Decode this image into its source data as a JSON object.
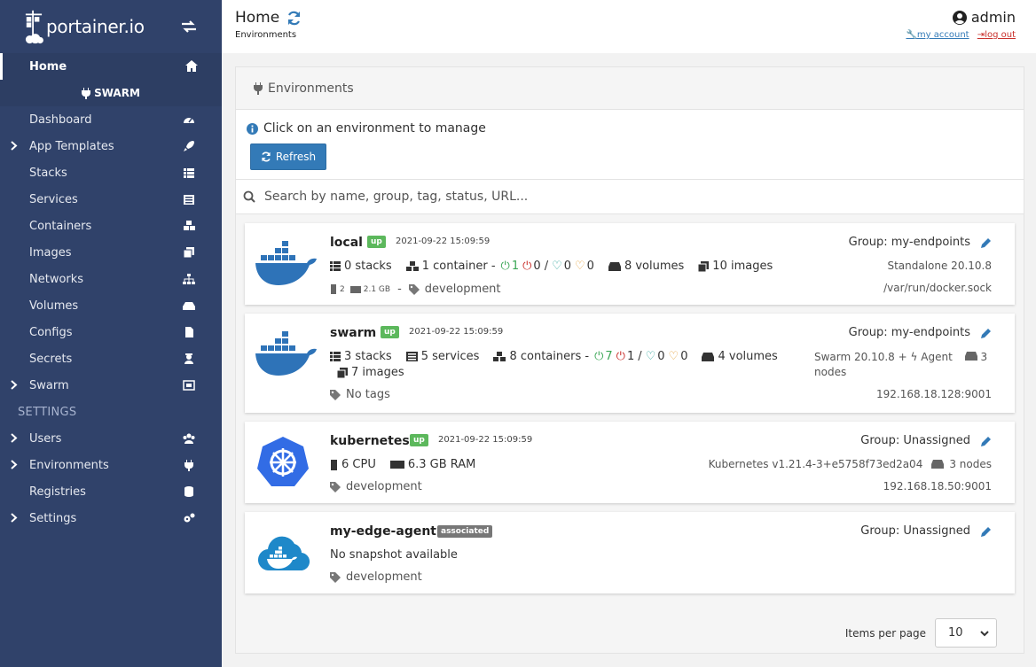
{
  "app": {
    "logo_text": "portainer.io"
  },
  "sidebar": {
    "home": "Home",
    "section": "SWARM",
    "items": [
      {
        "label": "Dashboard",
        "icon": "tachometer-icon",
        "chevron": false
      },
      {
        "label": "App Templates",
        "icon": "rocket-icon",
        "chevron": true
      },
      {
        "label": "Stacks",
        "icon": "th-list-icon",
        "chevron": false
      },
      {
        "label": "Services",
        "icon": "list-alt-icon",
        "chevron": false
      },
      {
        "label": "Containers",
        "icon": "cubes-icon",
        "chevron": false
      },
      {
        "label": "Images",
        "icon": "clone-icon",
        "chevron": false
      },
      {
        "label": "Networks",
        "icon": "sitemap-icon",
        "chevron": false
      },
      {
        "label": "Volumes",
        "icon": "hdd-icon",
        "chevron": false
      },
      {
        "label": "Configs",
        "icon": "file-code-icon",
        "chevron": false
      },
      {
        "label": "Secrets",
        "icon": "user-secret-icon",
        "chevron": false
      },
      {
        "label": "Swarm",
        "icon": "object-group-icon",
        "chevron": true
      }
    ],
    "settings_head": "SETTINGS",
    "settings_items": [
      {
        "label": "Users",
        "icon": "users-icon",
        "chevron": true
      },
      {
        "label": "Environments",
        "icon": "plug-icon",
        "chevron": true
      },
      {
        "label": "Registries",
        "icon": "database-icon",
        "chevron": false
      },
      {
        "label": "Settings",
        "icon": "cogs-icon",
        "chevron": true
      }
    ]
  },
  "header": {
    "title": "Home",
    "breadcrumb": "Environments",
    "user": "admin",
    "my_account": "my account",
    "log_out": "log out"
  },
  "widget": {
    "title": "Environments",
    "info": "Click on an environment to manage",
    "refresh": "Refresh",
    "search_placeholder": "Search by name, group, tag, status, URL..."
  },
  "environments": [
    {
      "name": "local",
      "status": "up",
      "time": "2021-09-22 15:09:59",
      "group": "Group: my-endpoints",
      "stacks": "0 stacks",
      "containers": "1 container -",
      "running": "1",
      "stopped": "0",
      "healthy": "0",
      "unhealthy": "0",
      "volumes": "8 volumes",
      "images": "10 images",
      "cpu": "2",
      "ram": "2.1 GB",
      "tag": "development",
      "version": "Standalone 20.10.8",
      "url": "/var/run/docker.sock"
    },
    {
      "name": "swarm",
      "status": "up",
      "time": "2021-09-22 15:09:59",
      "group": "Group: my-endpoints",
      "stacks": "3 stacks",
      "services": "5 services",
      "containers": "8 containers -",
      "running": "7",
      "stopped": "1",
      "healthy": "0",
      "unhealthy": "0",
      "volumes": "4 volumes",
      "images": "7 images",
      "tag": "No tags",
      "version": "Swarm 20.10.8 +",
      "agent": "Agent",
      "nodes": "3",
      "nodes_label": "nodes",
      "url": "192.168.18.128:9001"
    },
    {
      "name": "kubernetes",
      "status": "up",
      "time": "2021-09-22 15:09:59",
      "group": "Group: Unassigned",
      "cpu": "6 CPU",
      "ram": "6.3 GB RAM",
      "tag": "development",
      "version": "Kubernetes v1.21.4-3+e5758f73ed2a04",
      "nodes": "3 nodes",
      "url": "192.168.18.50:9001"
    },
    {
      "name": "my-edge-agent",
      "status": "associated",
      "group": "Group: Unassigned",
      "snapshot": "No snapshot available",
      "tag": "development"
    }
  ],
  "footer": {
    "items_per_page": "Items per page",
    "value": "10"
  }
}
